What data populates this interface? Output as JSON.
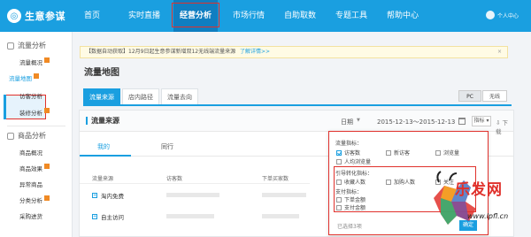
{
  "topnav": {
    "logo_text": "生意参谋",
    "items": [
      {
        "label": "首页"
      },
      {
        "label": "实时直播"
      },
      {
        "label": "经营分析"
      },
      {
        "label": "市场行情"
      },
      {
        "label": "自助取数"
      },
      {
        "label": "专题工具"
      },
      {
        "label": "帮助中心"
      }
    ],
    "user_label": "个人中心"
  },
  "sidebar": {
    "group1": "流量分析",
    "group1_items": [
      {
        "label": "流量概况"
      },
      {
        "label": "流量地图"
      },
      {
        "label": "访客分析"
      },
      {
        "label": "装修分析"
      }
    ],
    "group2": "商品分析",
    "group2_items": [
      {
        "label": "商品概况"
      },
      {
        "label": "商品效果"
      },
      {
        "label": "异常商品"
      },
      {
        "label": "分类分析"
      },
      {
        "label": "采购进货"
      }
    ]
  },
  "notice": {
    "text": "【数据自动获取】12月9日起生意参谋新增双12无线端流量来源",
    "link": "了解详情>>"
  },
  "page_title": "流量地图",
  "tabs": [
    {
      "label": "流量来源"
    },
    {
      "label": "店内路径"
    },
    {
      "label": "流量去向"
    }
  ],
  "device": {
    "pc": "PC",
    "wireless": "无线"
  },
  "card": {
    "title": "流量来源",
    "date_label": "日期",
    "date_range": "2015-12-13～2015-12-13",
    "metric_button": "指标",
    "download": "下载",
    "subtab_mine": "我的",
    "subtab_peer": "同行",
    "columns": [
      "流量来源",
      "访客数",
      "下单买家数"
    ],
    "rows": [
      {
        "source": "淘内免费"
      },
      {
        "source": "自主访问"
      }
    ]
  },
  "panel": {
    "group1": "流量指标：",
    "group1_items": [
      {
        "label": "访客数",
        "checked": true
      },
      {
        "label": "新访客",
        "checked": false
      },
      {
        "label": "浏览量",
        "checked": false
      },
      {
        "label": "人均浏览量",
        "checked": false
      }
    ],
    "group2": "引导转化指标：",
    "group2_items": [
      {
        "label": "收藏人数",
        "checked": false
      },
      {
        "label": "加购人数",
        "checked": false
      },
      {
        "label": "关注",
        "checked": false
      }
    ],
    "group3": "支付指标：",
    "group3_items": [
      {
        "label": "下单金额",
        "checked": false
      },
      {
        "label": "支付金额",
        "checked": false
      }
    ],
    "selected_text": "已选择3项",
    "ok": "确定"
  },
  "watermark": {
    "text": "乐发网",
    "url": "www.lpfl.cn"
  }
}
